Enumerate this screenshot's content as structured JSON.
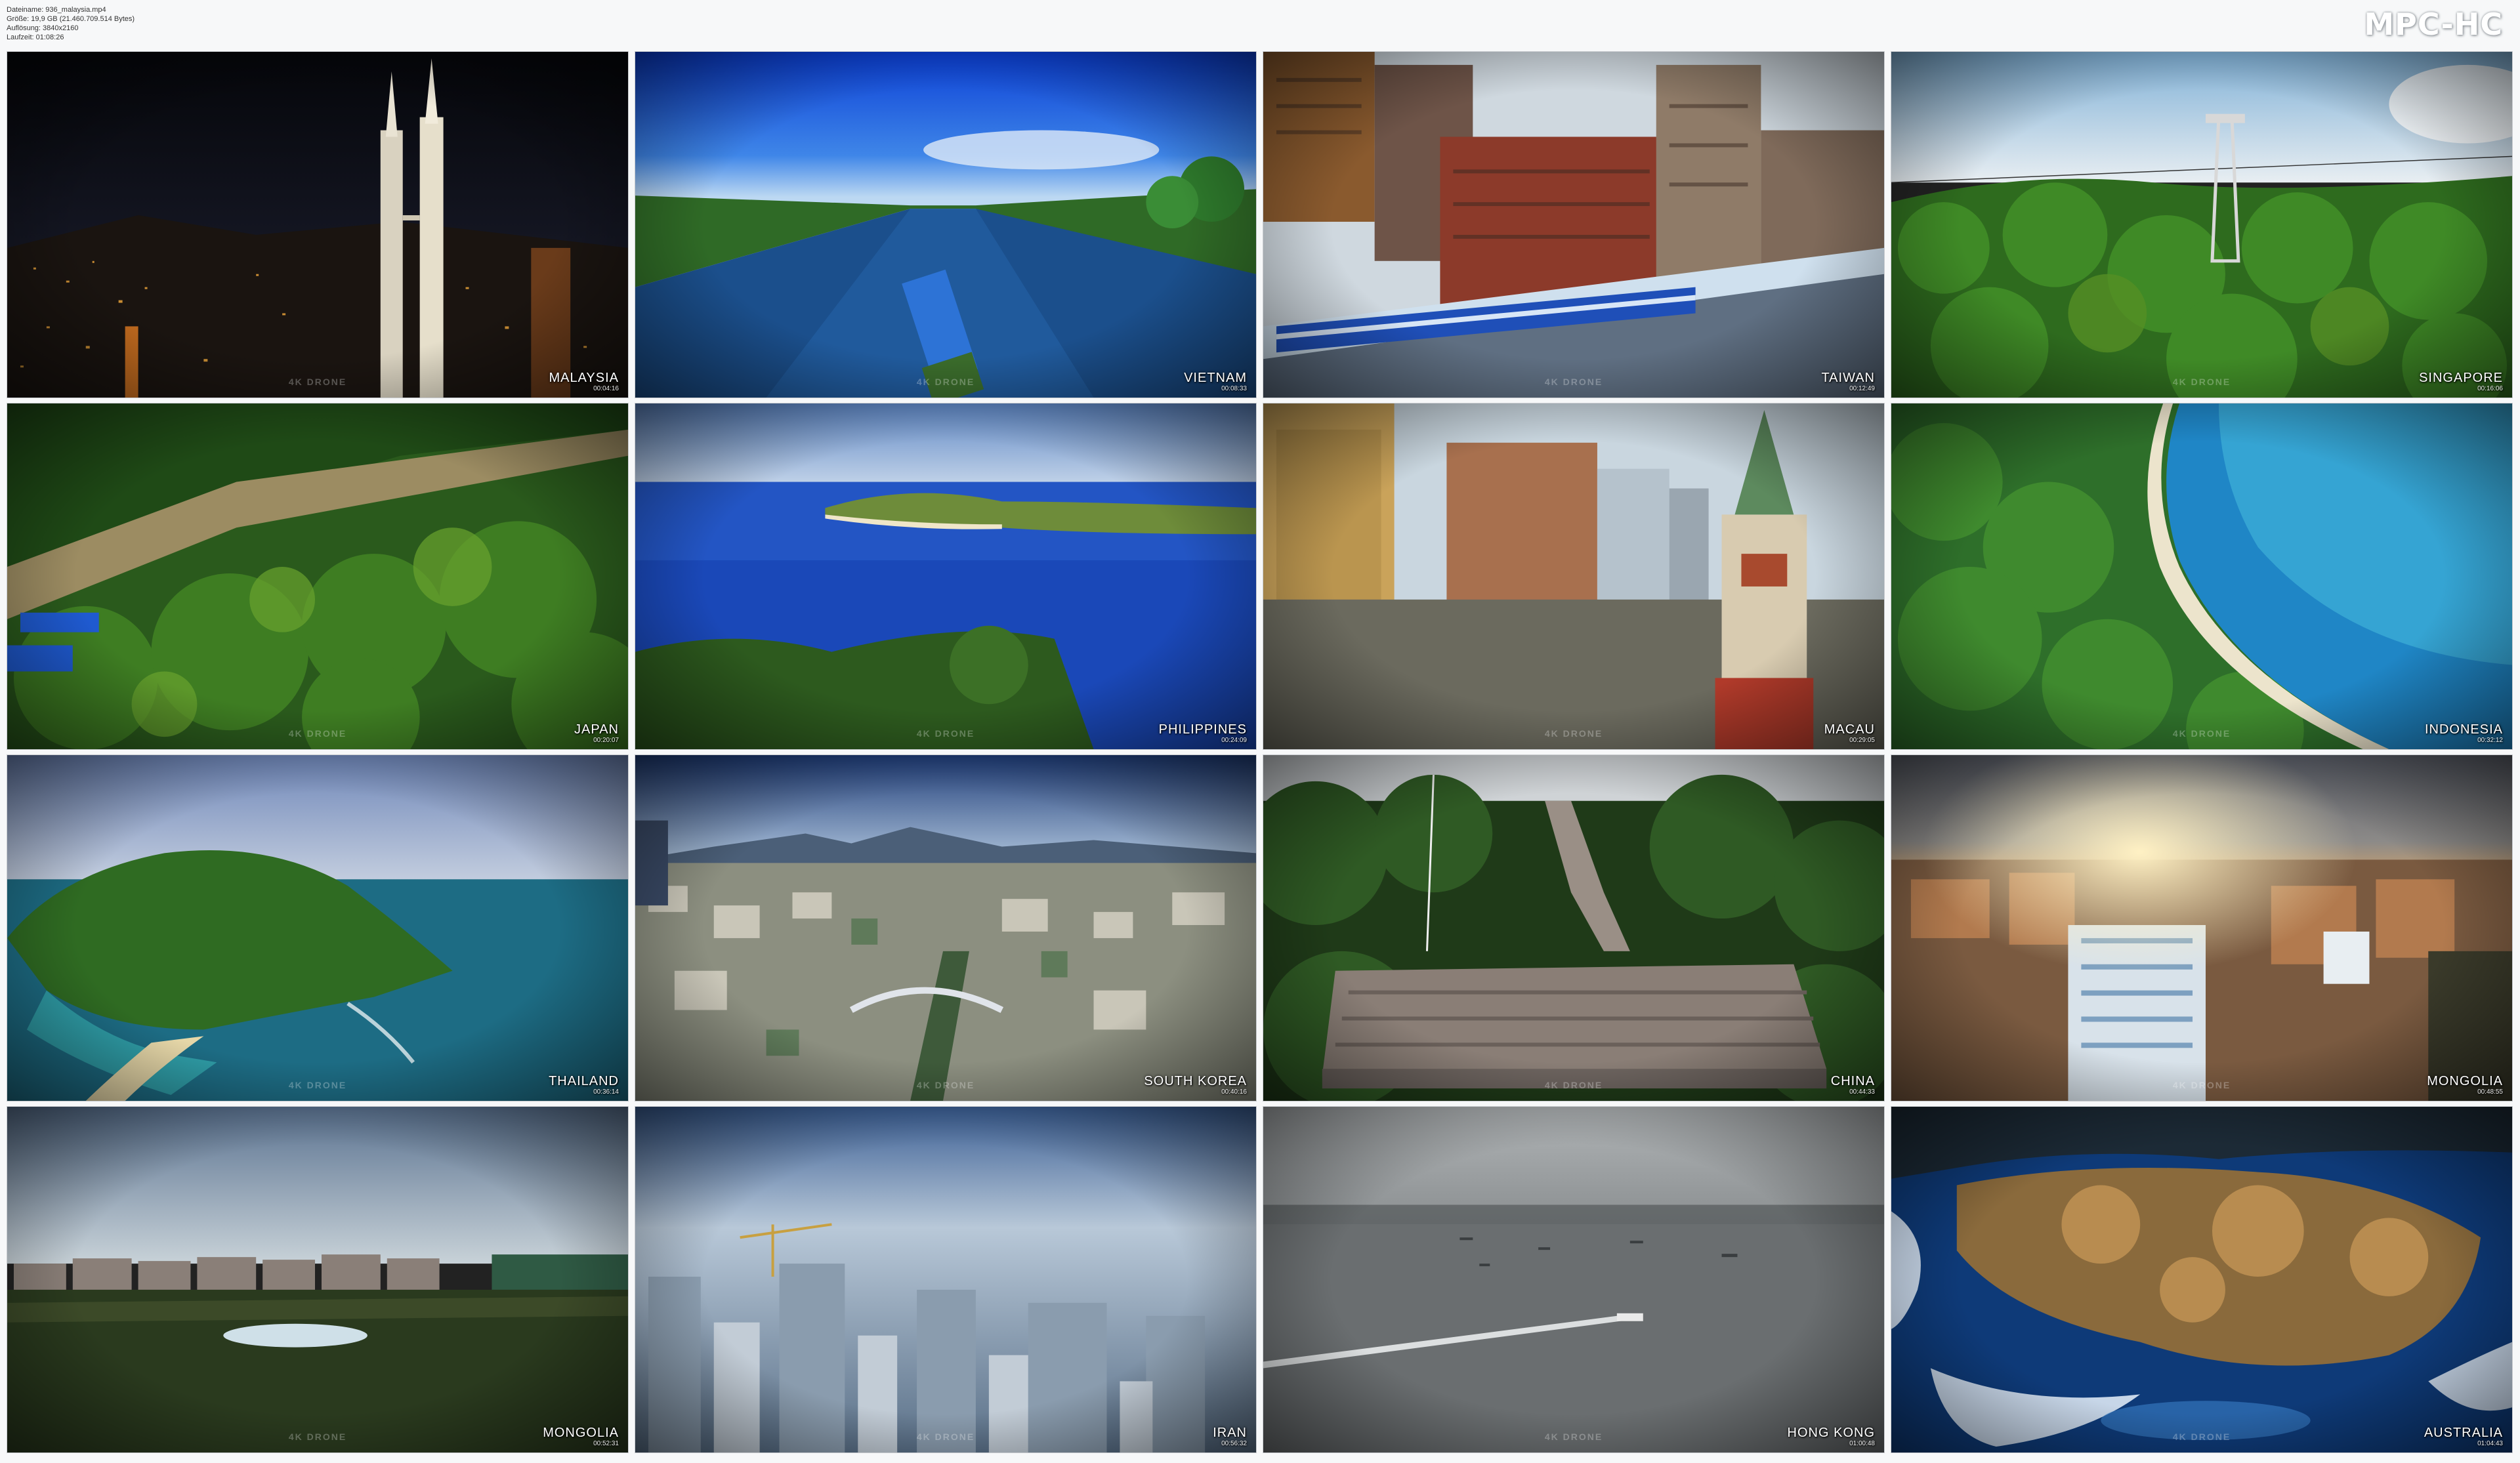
{
  "file_info": {
    "filename_line": "Dateiname: 936_malaysia.mp4",
    "size_line": "Größe: 19,9 GB (21.460.709.514 Bytes)",
    "resolution_line": "Auflösung: 3840x2160",
    "runtime_line": "Laufzeit: 01:08:26"
  },
  "app_logo": "MPC-HC",
  "watermark": "4K DRONE",
  "thumbnails": [
    {
      "country": "Malaysia",
      "time": "00:04:16"
    },
    {
      "country": "Vietnam",
      "time": "00:08:33"
    },
    {
      "country": "Taiwan",
      "time": "00:12:49"
    },
    {
      "country": "Singapore",
      "time": "00:16:06"
    },
    {
      "country": "Japan",
      "time": "00:20:07"
    },
    {
      "country": "Philippines",
      "time": "00:24:09"
    },
    {
      "country": "Macau",
      "time": "00:29:05"
    },
    {
      "country": "Indonesia",
      "time": "00:32:12"
    },
    {
      "country": "Thailand",
      "time": "00:36:14"
    },
    {
      "country": "South Korea",
      "time": "00:40:16"
    },
    {
      "country": "China",
      "time": "00:44:33"
    },
    {
      "country": "Mongolia",
      "time": "00:48:55"
    },
    {
      "country": "Mongolia",
      "time": "00:52:31"
    },
    {
      "country": "Iran",
      "time": "00:56:32"
    },
    {
      "country": "Hong Kong",
      "time": "01:00:48"
    },
    {
      "country": "Australia",
      "time": "01:04:43"
    }
  ]
}
